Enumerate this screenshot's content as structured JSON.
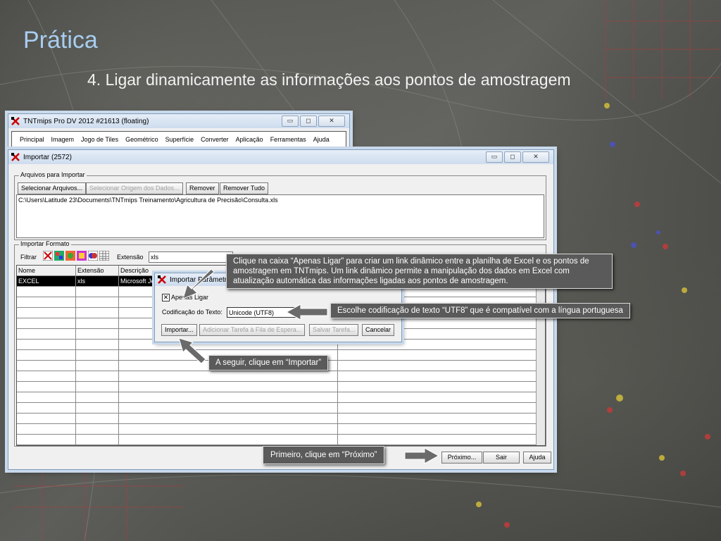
{
  "slide": {
    "title": "Prática",
    "subtitle": "4. Ligar dinamicamente as informações aos pontos de amostragem"
  },
  "main_window": {
    "title": "TNTmips Pro DV 2012  #21613 (floating)",
    "menu": [
      "Principal",
      "Imagem",
      "Jogo de Tiles",
      "Geométrico",
      "Superfície",
      "Converter",
      "Aplicação",
      "Ferramentas",
      "Ajuda"
    ]
  },
  "import_window": {
    "title": "Importar (2572)",
    "files_group": {
      "legend": "Arquivos para Importar",
      "select_files": "Selecionar Arquivos...",
      "select_source": "Selecionar Origem dos Dados...",
      "remove": "Remover",
      "remove_all": "Remover Tudo",
      "file_path": "C:\\Users\\Latitude 23\\Documents\\TNTmips Treinamento\\Agricultura de Precisão\\Consulta.xls"
    },
    "format_group": {
      "legend": "Importar Formato",
      "filter_label": "Filtrar",
      "extension_label": "Extensão",
      "extension_value": "xls",
      "columns": [
        "Nome",
        "Extensão",
        "Descrição"
      ],
      "rows": [
        {
          "name": "EXCEL",
          "ext": "xls",
          "desc": "Microsoft Je"
        }
      ]
    },
    "buttons": {
      "next": "Próximo...",
      "exit": "Sair",
      "help": "Ajuda"
    }
  },
  "params_dialog": {
    "title": "Importar Parâmetros",
    "link_only_label": "Apenas Ligar",
    "link_only_checked": true,
    "encoding_label": "Codificação do Texto:",
    "encoding_value": "Unicode (UTF8)",
    "buttons": {
      "import": "Importar...",
      "add_queue": "Adicionar Tarefa à Fila de Espera...",
      "save_task": "Salvar Tarefa...",
      "cancel": "Cancelar"
    }
  },
  "callouts": {
    "link": "Clique na caixa “Apenas Ligar” para criar um link dinâmico entre a planilha de Excel e os pontos de amostragem em TNTmips. Um link dinâmico permite a manipulação dos dados em Excel com atualização automática das informações  ligadas aos pontos de amostragem.",
    "encoding": "Escolhe codificação de texto “UTF8” que é compatível com a língua portuguesa",
    "import": "A seguir, clique em “Importar”",
    "next": "Primeiro, clique em “Próximo”"
  },
  "colors": {
    "title": "#a8cdf0",
    "callout_bg": "#5a5a5a",
    "selection": "#000000"
  }
}
